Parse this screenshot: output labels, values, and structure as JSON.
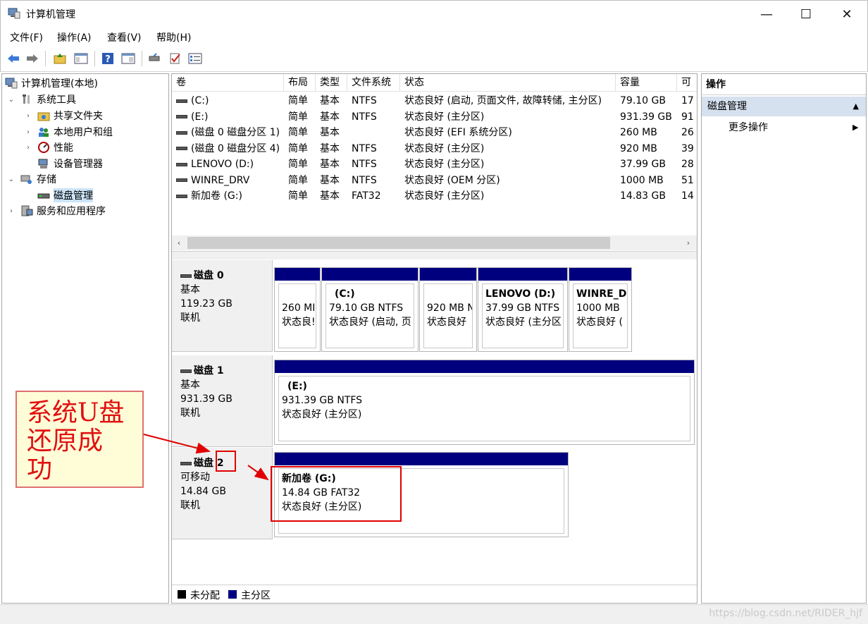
{
  "window": {
    "title": "计算机管理",
    "minimize": "—",
    "maximize": "☐",
    "close": "✕"
  },
  "menu": [
    "文件(F)",
    "操作(A)",
    "查看(V)",
    "帮助(H)"
  ],
  "toolbar": {
    "icons": [
      "back-arrow-icon",
      "forward-arrow-icon",
      "up-folder-icon",
      "show-hide-tree-icon",
      "help-icon",
      "properties-pane-icon",
      "connect-icon",
      "check-icon",
      "settings-list-icon"
    ]
  },
  "tree": {
    "root": "计算机管理(本地)",
    "system_tools": "系统工具",
    "shared_folders": "共享文件夹",
    "local_users": "本地用户和组",
    "performance": "性能",
    "device_manager": "设备管理器",
    "storage": "存储",
    "disk_management": "磁盘管理",
    "services": "服务和应用程序",
    "expand_down": "⌄",
    "expand_right": "›"
  },
  "volumes": {
    "columns": [
      "卷",
      "布局",
      "类型",
      "文件系统",
      "状态",
      "容量",
      "可"
    ],
    "rows": [
      {
        "vol": "(C:)",
        "layout": "简单",
        "type": "基本",
        "fs": "NTFS",
        "status": "状态良好 (启动, 页面文件, 故障转储, 主分区)",
        "cap": "79.10 GB",
        "free": "17"
      },
      {
        "vol": "(E:)",
        "layout": "简单",
        "type": "基本",
        "fs": "NTFS",
        "status": "状态良好 (主分区)",
        "cap": "931.39 GB",
        "free": "91"
      },
      {
        "vol": "(磁盘 0 磁盘分区 1)",
        "layout": "简单",
        "type": "基本",
        "fs": "",
        "status": "状态良好 (EFI 系统分区)",
        "cap": "260 MB",
        "free": "26"
      },
      {
        "vol": "(磁盘 0 磁盘分区 4)",
        "layout": "简单",
        "type": "基本",
        "fs": "NTFS",
        "status": "状态良好 (主分区)",
        "cap": "920 MB",
        "free": "39"
      },
      {
        "vol": "LENOVO (D:)",
        "layout": "简单",
        "type": "基本",
        "fs": "NTFS",
        "status": "状态良好 (主分区)",
        "cap": "37.99 GB",
        "free": "28"
      },
      {
        "vol": "WINRE_DRV",
        "layout": "简单",
        "type": "基本",
        "fs": "NTFS",
        "status": "状态良好 (OEM 分区)",
        "cap": "1000 MB",
        "free": "51"
      },
      {
        "vol": "新加卷 (G:)",
        "layout": "简单",
        "type": "基本",
        "fs": "FAT32",
        "status": "状态良好 (主分区)",
        "cap": "14.83 GB",
        "free": "14"
      }
    ],
    "scroll_left": "‹",
    "scroll_right": "›"
  },
  "disks": {
    "disk0": {
      "name": "磁盘 0",
      "type": "基本",
      "size": "119.23 GB",
      "state": "联机",
      "parts": [
        {
          "l1": "",
          "l2": "260 MI",
          "l3": "状态良!"
        },
        {
          "l1": "(C:)",
          "l2": "79.10 GB NTFS",
          "l3": "状态良好 (启动, 页"
        },
        {
          "l1": "",
          "l2": "920 MB N",
          "l3": "状态良好"
        },
        {
          "l1": "LENOVO  (D:)",
          "l2": "37.99 GB NTFS",
          "l3": "状态良好 (主分区"
        },
        {
          "l1": "WINRE_D",
          "l2": "1000 MB",
          "l3": "状态良好 ("
        }
      ]
    },
    "disk1": {
      "name": "磁盘 1",
      "type": "基本",
      "size": "931.39 GB",
      "state": "联机",
      "parts": [
        {
          "l1": "(E:)",
          "l2": "931.39 GB NTFS",
          "l3": "状态良好 (主分区)"
        }
      ]
    },
    "disk2": {
      "name_prefix": "磁盘",
      "name_num": "2",
      "type": "可移动",
      "size": "14.84 GB",
      "state": "联机",
      "parts": [
        {
          "l1": "新加卷  (G:)",
          "l2": "14.84 GB FAT32",
          "l3": "状态良好 (主分区)"
        }
      ]
    }
  },
  "legend": {
    "unallocated": "未分配",
    "primary": "主分区",
    "unallocated_color": "#000000",
    "primary_color": "#00007f"
  },
  "actions": {
    "header": "操作",
    "section": "磁盘管理",
    "section_arrow": "▲",
    "more": "更多操作",
    "more_arrow": "▶"
  },
  "annotation": {
    "callout_text": "系统U盘还原成功",
    "line1": "系统U盘",
    "line2": "还原成",
    "line3": "功",
    "color": "#e00000"
  },
  "watermark": "https://blog.csdn.net/RIDER_hjf"
}
